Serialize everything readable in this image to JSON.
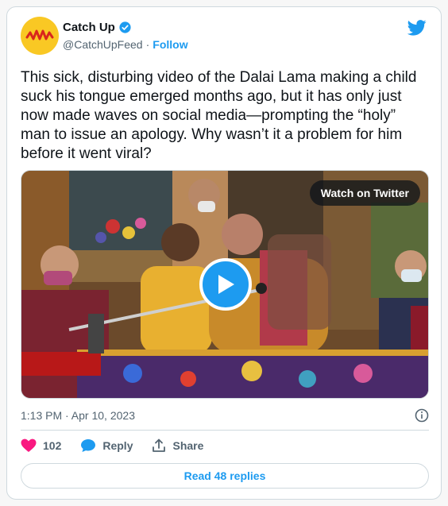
{
  "author": {
    "display_name": "Catch Up",
    "handle": "@CatchUpFeed",
    "separator": "·",
    "follow_label": "Follow",
    "avatar_color": "#f9c824",
    "verified_color": "#1d9bf0"
  },
  "tweet": {
    "text": "This sick, disturbing video of the Dalai Lama making a child suck his tongue emerged months ago, but it has only just now made waves on social media—prompting the “holy” man to issue an apology. Why wasn’t it a problem for him before it went viral?",
    "timestamp": "1:13 PM · Apr 10, 2023"
  },
  "media": {
    "watch_label": "Watch on Twitter",
    "play_icon": "play-icon"
  },
  "actions": {
    "like_count": "102",
    "reply_label": "Reply",
    "share_label": "Share",
    "read_replies_label": "Read 48 replies"
  },
  "colors": {
    "accent": "#1d9bf0",
    "like": "#f91880",
    "text": "#0f1419",
    "muted": "#536471"
  }
}
